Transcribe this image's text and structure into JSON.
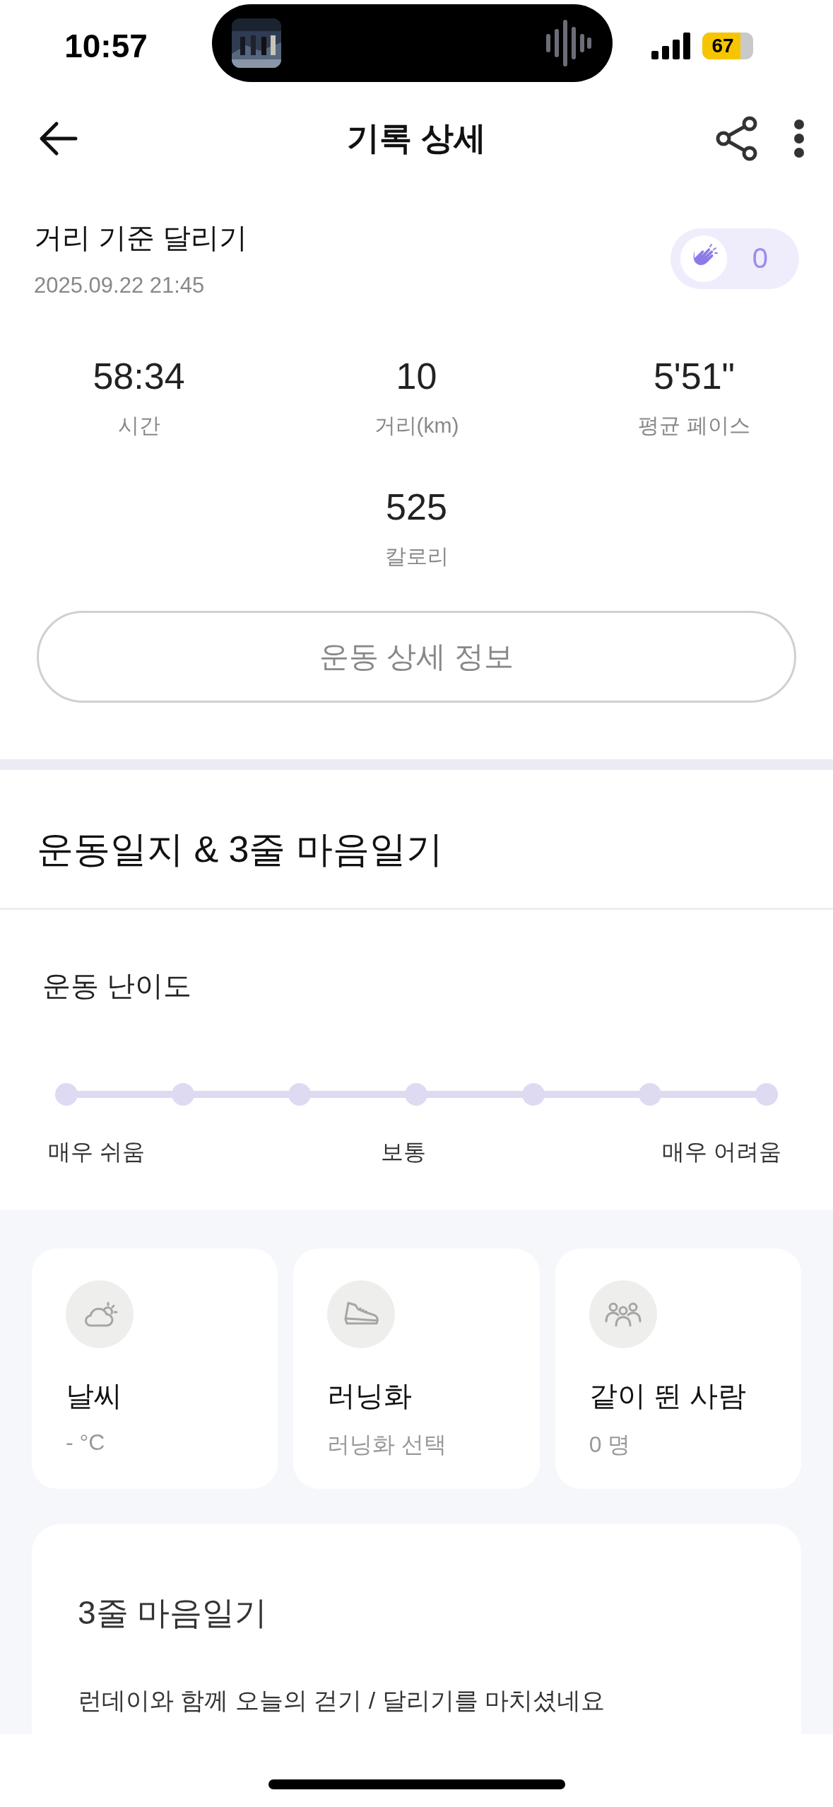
{
  "status_bar": {
    "time": "10:57",
    "battery": "67"
  },
  "header": {
    "title": "기록 상세"
  },
  "workout": {
    "title": "거리 기준 달리기",
    "date": "2025.09.22 21:45",
    "claps": "0"
  },
  "stats": [
    {
      "value": "58:34",
      "label": "시간"
    },
    {
      "value": "10",
      "label": "거리(km)"
    },
    {
      "value": "5'51\"",
      "label": "평균 페이스"
    },
    {
      "value": "525",
      "label": "칼로리"
    }
  ],
  "detail_button": {
    "label": "운동 상세 정보"
  },
  "journal": {
    "title": "운동일지 & 3줄 마음일기"
  },
  "difficulty": {
    "title": "운동 난이도",
    "steps": [
      {
        "selected": false
      },
      {
        "selected": false
      },
      {
        "selected": false
      },
      {
        "selected": false
      },
      {
        "selected": false
      },
      {
        "selected": false
      },
      {
        "selected": false
      }
    ],
    "labels": [
      "매우 쉬움",
      "보통",
      "매우 어려움"
    ]
  },
  "info_cards": [
    {
      "kind": "weather",
      "title": "날씨",
      "value": "- °C"
    },
    {
      "kind": "shoes",
      "title": "러닝화",
      "value": "러닝화 선택"
    },
    {
      "kind": "people",
      "title": "같이 뛴 사람",
      "value": "0 명"
    }
  ],
  "diary": {
    "title": "3줄 마음일기",
    "text": "런데이와 함께 오늘의 걷기 / 달리기를 마치셨네요"
  }
}
